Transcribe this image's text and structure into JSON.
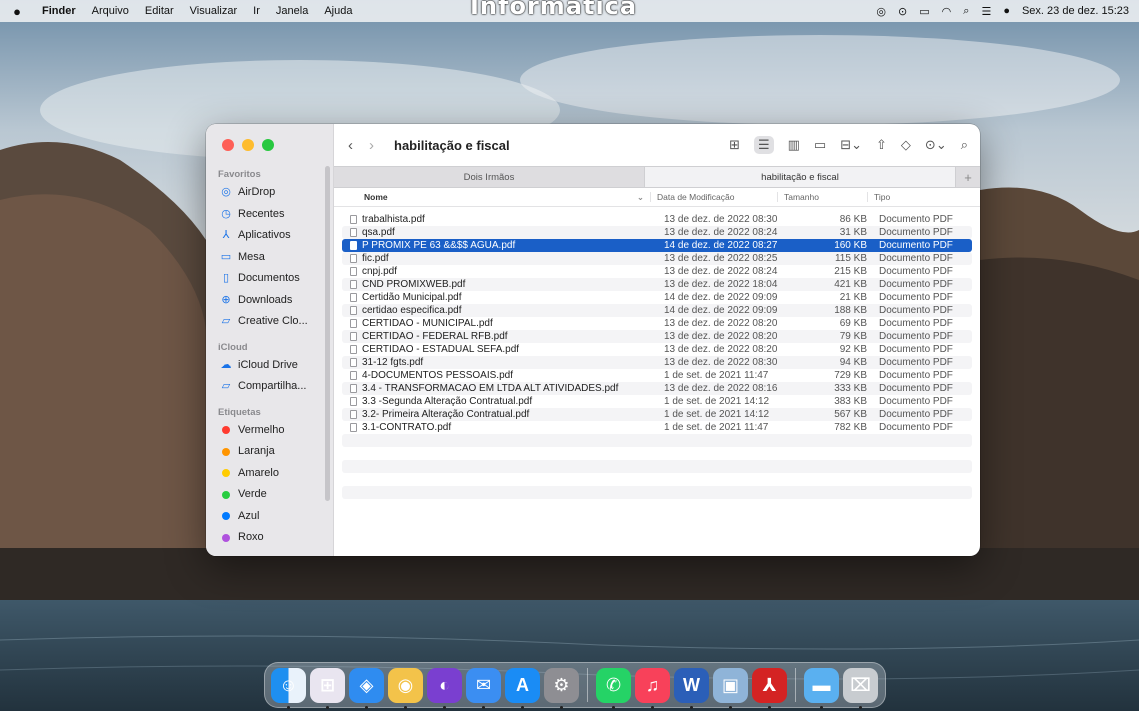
{
  "watermark": "Informática",
  "menubar": {
    "app": "Finder",
    "items": [
      "Arquivo",
      "Editar",
      "Visualizar",
      "Ir",
      "Janela",
      "Ajuda"
    ],
    "clock": "Sex. 23 de dez. 15:23"
  },
  "window": {
    "title": "habilitação e fiscal",
    "tabs": [
      {
        "label": "Dois Irmãos",
        "active": false
      },
      {
        "label": "habilitação e fiscal",
        "active": true
      }
    ],
    "tab_add": "+",
    "columns": {
      "name": "Nome",
      "date": "Data de Modificação",
      "size": "Tamanho",
      "kind": "Tipo"
    },
    "files": [
      {
        "name": "trabalhista.pdf",
        "date": "13 de dez. de 2022 08:30",
        "size": "86 KB",
        "kind": "Documento PDF",
        "selected": false
      },
      {
        "name": "qsa.pdf",
        "date": "13 de dez. de 2022 08:24",
        "size": "31 KB",
        "kind": "Documento PDF",
        "selected": false
      },
      {
        "name": "P PROMIX PE 63 &&$$ AGUA.pdf",
        "date": "14 de dez. de 2022 08:27",
        "size": "160 KB",
        "kind": "Documento PDF",
        "selected": true
      },
      {
        "name": "fic.pdf",
        "date": "13 de dez. de 2022 08:25",
        "size": "115 KB",
        "kind": "Documento PDF",
        "selected": false
      },
      {
        "name": "cnpj.pdf",
        "date": "13 de dez. de 2022 08:24",
        "size": "215 KB",
        "kind": "Documento PDF",
        "selected": false
      },
      {
        "name": "CND PROMIXWEB.pdf",
        "date": "13 de dez. de 2022 18:04",
        "size": "421 KB",
        "kind": "Documento PDF",
        "selected": false
      },
      {
        "name": "Certidão Municipal.pdf",
        "date": "14 de dez. de 2022 09:09",
        "size": "21 KB",
        "kind": "Documento PDF",
        "selected": false
      },
      {
        "name": "certidao especifica.pdf",
        "date": "14 de dez. de 2022 09:09",
        "size": "188 KB",
        "kind": "Documento PDF",
        "selected": false
      },
      {
        "name": "CERTIDAO - MUNICIPAL.pdf",
        "date": "13 de dez. de 2022 08:20",
        "size": "69 KB",
        "kind": "Documento PDF",
        "selected": false
      },
      {
        "name": "CERTIDAO - FEDERAL RFB.pdf",
        "date": "13 de dez. de 2022 08:20",
        "size": "79 KB",
        "kind": "Documento PDF",
        "selected": false
      },
      {
        "name": "CERTIDAO - ESTADUAL SEFA.pdf",
        "date": "13 de dez. de 2022 08:20",
        "size": "92 KB",
        "kind": "Documento PDF",
        "selected": false
      },
      {
        "name": "31-12 fgts.pdf",
        "date": "13 de dez. de 2022 08:30",
        "size": "94 KB",
        "kind": "Documento PDF",
        "selected": false
      },
      {
        "name": "4-DOCUMENTOS PESSOAIS.pdf",
        "date": "1 de set. de 2021 11:47",
        "size": "729 KB",
        "kind": "Documento PDF",
        "selected": false
      },
      {
        "name": "3.4 - TRANSFORMACAO EM LTDA ALT ATIVIDADES.pdf",
        "date": "13 de dez. de 2022 08:16",
        "size": "333 KB",
        "kind": "Documento PDF",
        "selected": false
      },
      {
        "name": "3.3 -Segunda Alteração Contratual.pdf",
        "date": "1 de set. de 2021 14:12",
        "size": "383 KB",
        "kind": "Documento PDF",
        "selected": false
      },
      {
        "name": "3.2- Primeira Alteração Contratual.pdf",
        "date": "1 de set. de 2021 14:12",
        "size": "567 KB",
        "kind": "Documento PDF",
        "selected": false
      },
      {
        "name": "3.1-CONTRATO.pdf",
        "date": "1 de set. de 2021 11:47",
        "size": "782 KB",
        "kind": "Documento PDF",
        "selected": false
      }
    ]
  },
  "sidebar": {
    "favorites_heading": "Favoritos",
    "favorites": [
      {
        "label": "AirDrop",
        "icon": "airdrop-icon",
        "glyph": "◎"
      },
      {
        "label": "Recentes",
        "icon": "clock-icon",
        "glyph": "◷"
      },
      {
        "label": "Aplicativos",
        "icon": "applications-icon",
        "glyph": "⅄"
      },
      {
        "label": "Mesa",
        "icon": "desktop-icon",
        "glyph": "▭"
      },
      {
        "label": "Documentos",
        "icon": "document-icon",
        "glyph": "▯"
      },
      {
        "label": "Downloads",
        "icon": "download-icon",
        "glyph": "⊕"
      },
      {
        "label": "Creative Clo...",
        "icon": "folder-icon",
        "glyph": "▱"
      }
    ],
    "icloud_heading": "iCloud",
    "icloud": [
      {
        "label": "iCloud Drive",
        "icon": "cloud-icon",
        "glyph": "☁"
      },
      {
        "label": "Compartilha...",
        "icon": "shared-folder-icon",
        "glyph": "▱"
      }
    ],
    "tags_heading": "Etiquetas",
    "tags": [
      {
        "label": "Vermelho",
        "color": "#ff3b30"
      },
      {
        "label": "Laranja",
        "color": "#ff9500"
      },
      {
        "label": "Amarelo",
        "color": "#ffcc00"
      },
      {
        "label": "Verde",
        "color": "#28cd41"
      },
      {
        "label": "Azul",
        "color": "#007aff"
      },
      {
        "label": "Roxo",
        "color": "#af52de"
      }
    ]
  },
  "dock": [
    {
      "name": "finder-icon",
      "bg": "linear-gradient(90deg,#1e8ff0 50%,#e9f2fb 50%)",
      "glyph": "☺"
    },
    {
      "name": "launchpad-icon",
      "bg": "#e9e5f0",
      "glyph": "⊞"
    },
    {
      "name": "safari-icon",
      "bg": "#2f8cf0",
      "glyph": "◈"
    },
    {
      "name": "chrome-icon",
      "bg": "#f3c34a",
      "glyph": "◉"
    },
    {
      "name": "firefox-icon",
      "bg": "#7a3fd0",
      "glyph": "◐"
    },
    {
      "name": "mail-icon",
      "bg": "#3b8ef2",
      "glyph": "✉"
    },
    {
      "name": "app-store-icon",
      "bg": "#1a8cf5",
      "glyph": "A"
    },
    {
      "name": "system-preferences-icon",
      "bg": "#8e8e93",
      "glyph": "⚙"
    },
    {
      "name": "whatsapp-icon",
      "bg": "#25d366",
      "glyph": "✆"
    },
    {
      "name": "music-icon",
      "bg": "#f8415a",
      "glyph": "♫"
    },
    {
      "name": "word-icon",
      "bg": "#2b5fb8",
      "glyph": "W"
    },
    {
      "name": "preview-icon",
      "bg": "#8fb4d8",
      "glyph": "▣"
    },
    {
      "name": "acrobat-icon",
      "bg": "#d42323",
      "glyph": "⅄"
    },
    {
      "name": "downloads-folder-icon",
      "bg": "#5ab0f0",
      "glyph": "▬"
    },
    {
      "name": "trash-icon",
      "bg": "#c8ccd0",
      "glyph": "⌧"
    }
  ]
}
